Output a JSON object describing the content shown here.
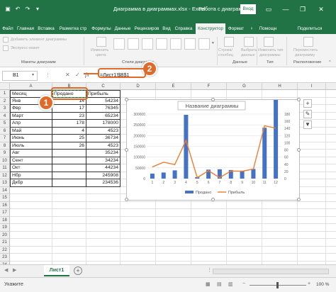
{
  "titlebar": {
    "title": "Диаграмма в диаграммах.xlsx  -  Excel",
    "context": "Работа с диаграм...",
    "login": "Вход",
    "minimize": "—",
    "restore": "❐",
    "close": "✕"
  },
  "tabs": [
    "Файл",
    "Главная",
    "Вставка",
    "Разметка стр",
    "Формулы",
    "Данные",
    "Рецензиров",
    "Вид",
    "Справка",
    "Конструктор",
    "Формат",
    "♀",
    "Помощн",
    "Поделиться"
  ],
  "active_tab": "Конструктор",
  "ribbon": {
    "add_element": "Добавить элемент диаграммы",
    "express_layout": "Экспресс-макет",
    "change_colors_1": "Изменить",
    "change_colors_2": "цвета",
    "row_col_1": "Строка/столбец",
    "select_data_1": "Выбрать",
    "select_data_2": "данные",
    "change_type_1": "Изменить тип",
    "change_type_2": "диаграммы",
    "move_1": "Переместить",
    "move_2": "диаграмму",
    "group_layouts": "Макеты диаграмм",
    "group_styles": "Стили диаграмм",
    "group_data": "Данные",
    "group_type": "Тип",
    "group_location": "Расположение"
  },
  "formula_bar": {
    "name_box": "B1",
    "formula": "=Лист1!$B$1",
    "fx": "fx"
  },
  "columns": [
    "A",
    "B",
    "C",
    "D",
    "E",
    "F",
    "G",
    "H",
    "I",
    "J"
  ],
  "rows": [
    "1",
    "2",
    "3",
    "4",
    "5",
    "6",
    "7",
    "8",
    "9",
    "10",
    "11",
    "12",
    "13",
    "14",
    "15",
    "16",
    "17",
    "18",
    "19",
    "20",
    "21",
    "22",
    "23",
    "24"
  ],
  "table": {
    "headers": [
      "Месяц",
      "Продано",
      "Прибыль"
    ],
    "months": [
      "Янв",
      "Фвр",
      "Март",
      "Апр",
      "Май",
      "Июнь",
      "Июль",
      "Авг",
      "Сент",
      "Окт",
      "Нбр",
      "Дкбр"
    ],
    "sold": [
      "14",
      "17",
      "23",
      "178",
      "4",
      "25",
      "26",
      "",
      "",
      "",
      "",
      ""
    ],
    "profit": [
      "54234",
      "76345",
      "65234",
      "178000",
      "4523",
      "36734",
      "4523",
      "35234",
      "34234",
      "44234",
      "245908",
      "234536"
    ]
  },
  "chart_data": {
    "type": "bar",
    "title": "Название диаграммы",
    "categories": [
      "1",
      "2",
      "3",
      "4",
      "5",
      "6",
      "7",
      "8",
      "9",
      "10",
      "11",
      "12"
    ],
    "series": [
      {
        "name": "Продано",
        "axis": "left",
        "color": "#4472c4",
        "values": [
          14,
          17,
          23,
          178,
          4,
          25,
          26,
          24,
          22,
          27,
          142,
          224
        ]
      },
      {
        "name": "Прибыль",
        "axis": "left",
        "color": "#ed7d31",
        "values": [
          54234,
          76345,
          65234,
          178000,
          4523,
          36734,
          4523,
          35234,
          34234,
          44234,
          245908,
          234536
        ]
      }
    ],
    "y_left_ticks": [
      "300000",
      "250000",
      "200000",
      "150000",
      "100000",
      "50000",
      "0"
    ],
    "y_right_ticks": [
      "180",
      "160",
      "140",
      "120",
      "100",
      "80",
      "60",
      "40",
      "20",
      "0"
    ],
    "ylim_left": [
      0,
      300000
    ],
    "ylim_right": [
      0,
      180
    ],
    "legend": "bottom"
  },
  "callouts": {
    "one": "1",
    "two": "2"
  },
  "sheet_tab": "Лист1",
  "status": {
    "ready": "Укажите",
    "zoom": "100 %"
  }
}
